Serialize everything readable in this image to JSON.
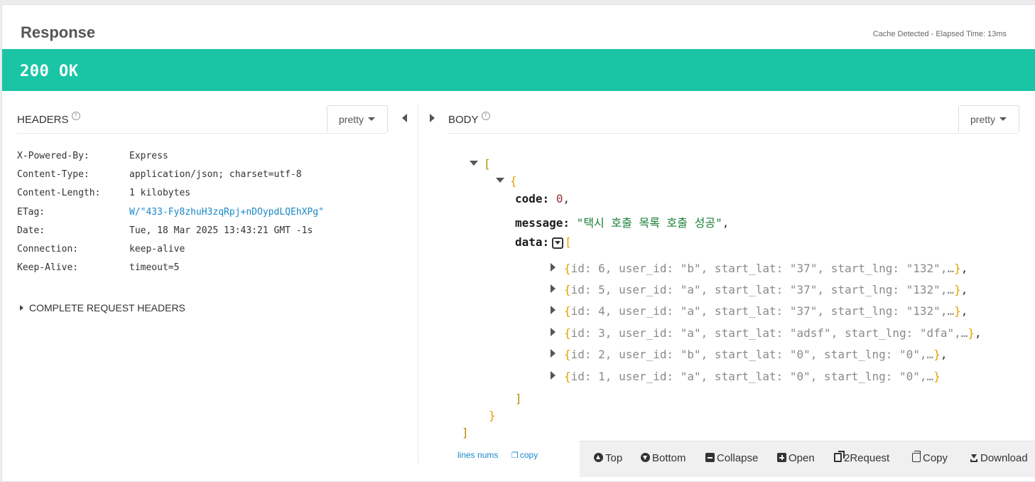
{
  "response": {
    "title": "Response",
    "cache_info": "Cache Detected - Elapsed Time: 13ms",
    "status": "200 OK",
    "status_color": "#1ac5a6"
  },
  "headers_section": {
    "label": "HEADERS",
    "help_icon": "question-circle-icon",
    "format": "pretty",
    "rows": [
      {
        "key": "X-Powered-By:",
        "value": "Express"
      },
      {
        "key": "Content-Type:",
        "value": "application/json; charset=utf-8"
      },
      {
        "key": "Content-Length:",
        "value": "1 kilobytes"
      },
      {
        "key": "ETag:",
        "value": "W/\"433-Fy8zhuH3zqRpj+nDOypdLQEhXPg\""
      },
      {
        "key": "Date:",
        "value": "Tue, 18 Mar 2025 13:43:21 GMT -1s"
      },
      {
        "key": "Connection:",
        "value": "keep-alive"
      },
      {
        "key": "Keep-Alive:",
        "value": "timeout=5"
      }
    ],
    "complete_request": "COMPLETE REQUEST HEADERS"
  },
  "body_section": {
    "label": "BODY",
    "format": "pretty",
    "json": {
      "open_bracket": "[",
      "close_bracket": "]",
      "open_brace": "{",
      "close_brace": "}",
      "code_key": "code:",
      "code_value": "0",
      "message_key": "message:",
      "message_value": "\"택시 호출 목록 호출 성공\"",
      "data_key": "data:",
      "items": [
        {
          "summary": "id:  6, user_id:  \"b\", start_lat:  \"37\", start_lng:  \"132\",…",
          "trail": ","
        },
        {
          "summary": "id:  5, user_id:  \"a\", start_lat:  \"37\", start_lng:  \"132\",…",
          "trail": ","
        },
        {
          "summary": "id:  4, user_id:  \"a\", start_lat:  \"37\", start_lng:  \"132\",…",
          "trail": ","
        },
        {
          "summary": "id:  3, user_id:  \"a\", start_lat:  \"adsf\", start_lng:  \"dfa\",…",
          "trail": ","
        },
        {
          "summary": "id:  2, user_id:  \"b\", start_lat:  \"0\", start_lng:  \"0\",…",
          "trail": ","
        },
        {
          "summary": "id:  1, user_id:  \"a\", start_lat:  \"0\", start_lng:  \"0\",…",
          "trail": ""
        }
      ]
    },
    "lines_nums": "lines nums",
    "copy": "copy"
  },
  "toolbar": {
    "top": "Top",
    "bottom": "Bottom",
    "collapse": "Collapse",
    "open": "Open",
    "to_request": "2Request",
    "copy": "Copy",
    "download": "Download"
  }
}
